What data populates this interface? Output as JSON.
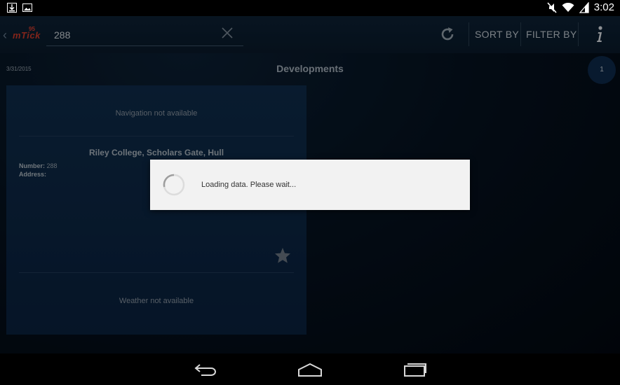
{
  "status_bar": {
    "time": "3:02",
    "left_icons": [
      "download-icon",
      "image-icon"
    ],
    "right_icons": [
      "mute-icon",
      "wifi-icon",
      "battery-icon"
    ]
  },
  "toolbar": {
    "logo_text": "mTick",
    "logo_badge": "95",
    "search_value": "288",
    "sort_label": "SORT BY",
    "filter_label": "FILTER BY"
  },
  "header": {
    "date": "3/31/2015",
    "title": "Developments",
    "count": "1"
  },
  "card": {
    "navigation": "Navigation not available",
    "title": "Riley College, Scholars Gate, Hull",
    "number_label": "Number:",
    "number_value": "288",
    "address_label": "Address:",
    "address_value": "",
    "weather": "Weather not available"
  },
  "dialog": {
    "message": "Loading data. Please wait..."
  },
  "colors": {
    "accent": "#d23a2a",
    "card_bg": "#0f2d4c",
    "dialog_bg": "#f2f2f2"
  }
}
